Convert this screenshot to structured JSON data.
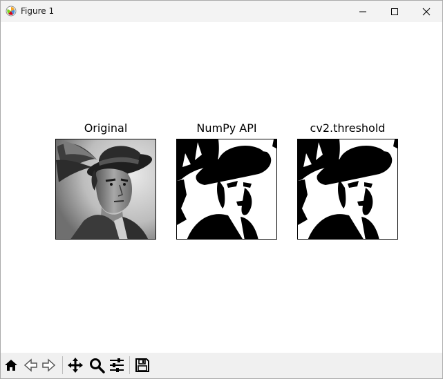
{
  "window": {
    "title": "Figure 1",
    "controls": {
      "minimize": "minimize",
      "maximize": "maximize",
      "close": "close"
    }
  },
  "figure": {
    "subplots": [
      {
        "title": "Original",
        "image": "grayscale portrait of a man wearing a feathered hat"
      },
      {
        "title": "NumPy API",
        "image": "binary thresholded portrait"
      },
      {
        "title": "cv2.threshold",
        "image": "binary thresholded portrait"
      }
    ]
  },
  "toolbar": {
    "buttons": [
      {
        "icon": "home-icon",
        "label": "Home"
      },
      {
        "icon": "back-icon",
        "label": "Back"
      },
      {
        "icon": "forward-icon",
        "label": "Forward"
      },
      {
        "icon": "pan-icon",
        "label": "Pan"
      },
      {
        "icon": "zoom-icon",
        "label": "Zoom"
      },
      {
        "icon": "configure-subplots-icon",
        "label": "Subplots"
      },
      {
        "icon": "save-icon",
        "label": "Save"
      }
    ]
  },
  "colors": {
    "titlebar": "#f3f3f3",
    "toolbar": "#f0f0f0",
    "canvas": "#ffffff"
  }
}
